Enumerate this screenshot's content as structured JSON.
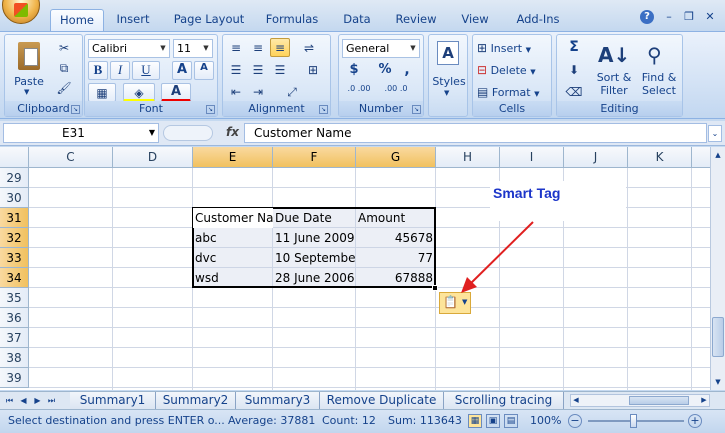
{
  "ribbon_tabs": [
    "Home",
    "Insert",
    "Page Layout",
    "Formulas",
    "Data",
    "Review",
    "View",
    "Add-Ins"
  ],
  "active_tab": "Home",
  "clipboard": {
    "paste_label": "Paste",
    "group_label": "Clipboard"
  },
  "font": {
    "name": "Calibri",
    "size": "11",
    "bold": "B",
    "italic": "I",
    "underline": "U",
    "grow": "A",
    "shrink": "A",
    "font_color": "A",
    "group_label": "Font"
  },
  "alignment": {
    "group_label": "Alignment"
  },
  "number": {
    "format": "General",
    "currency": "$",
    "percent": "%",
    "comma": ",",
    "inc_decimal": ".0 .00",
    "dec_decimal": ".00 .0",
    "group_label": "Number"
  },
  "styles": {
    "label": "Styles"
  },
  "cells": {
    "insert": "Insert",
    "delete": "Delete",
    "format": "Format",
    "group_label": "Cells"
  },
  "editing": {
    "sum": "Σ",
    "sort_filter_1": "Sort &",
    "sort_filter_2": "Filter",
    "find_select_1": "Find &",
    "find_select_2": "Select",
    "group_label": "Editing"
  },
  "formula_bar": {
    "name_box": "E31",
    "fx": "fx",
    "formula": "Customer Name"
  },
  "columns": [
    "C",
    "D",
    "E",
    "F",
    "G",
    "H",
    "I",
    "J",
    "K"
  ],
  "rows": [
    "29",
    "30",
    "31",
    "32",
    "33",
    "34",
    "35",
    "36",
    "37",
    "38",
    "39"
  ],
  "table": {
    "headers": [
      "Customer Na",
      "Due Date",
      "Amount"
    ],
    "rows": [
      [
        "abc",
        "11 June 2009",
        "45678"
      ],
      [
        "dvc",
        "10 Septembe",
        "77"
      ],
      [
        "wsd",
        "28 June 2006",
        "67888"
      ]
    ]
  },
  "annotation": {
    "callout": "Smart Tag",
    "arrow_color": "#e02020"
  },
  "sheet_tabs": [
    "Summary1",
    "Summary2",
    "Summary3",
    "Remove Duplicate",
    "Scrolling tracing"
  ],
  "status": {
    "message": "Select destination and press ENTER o...",
    "average": "Average: 37881",
    "count": "Count: 12",
    "sum": "Sum: 113643",
    "zoom": "100%"
  },
  "colors": {
    "ribbon": "#dbe7f6",
    "selection_header": "#f1c15f",
    "smart_tag": "#fde49a",
    "callout_text": "#1c35c9"
  }
}
